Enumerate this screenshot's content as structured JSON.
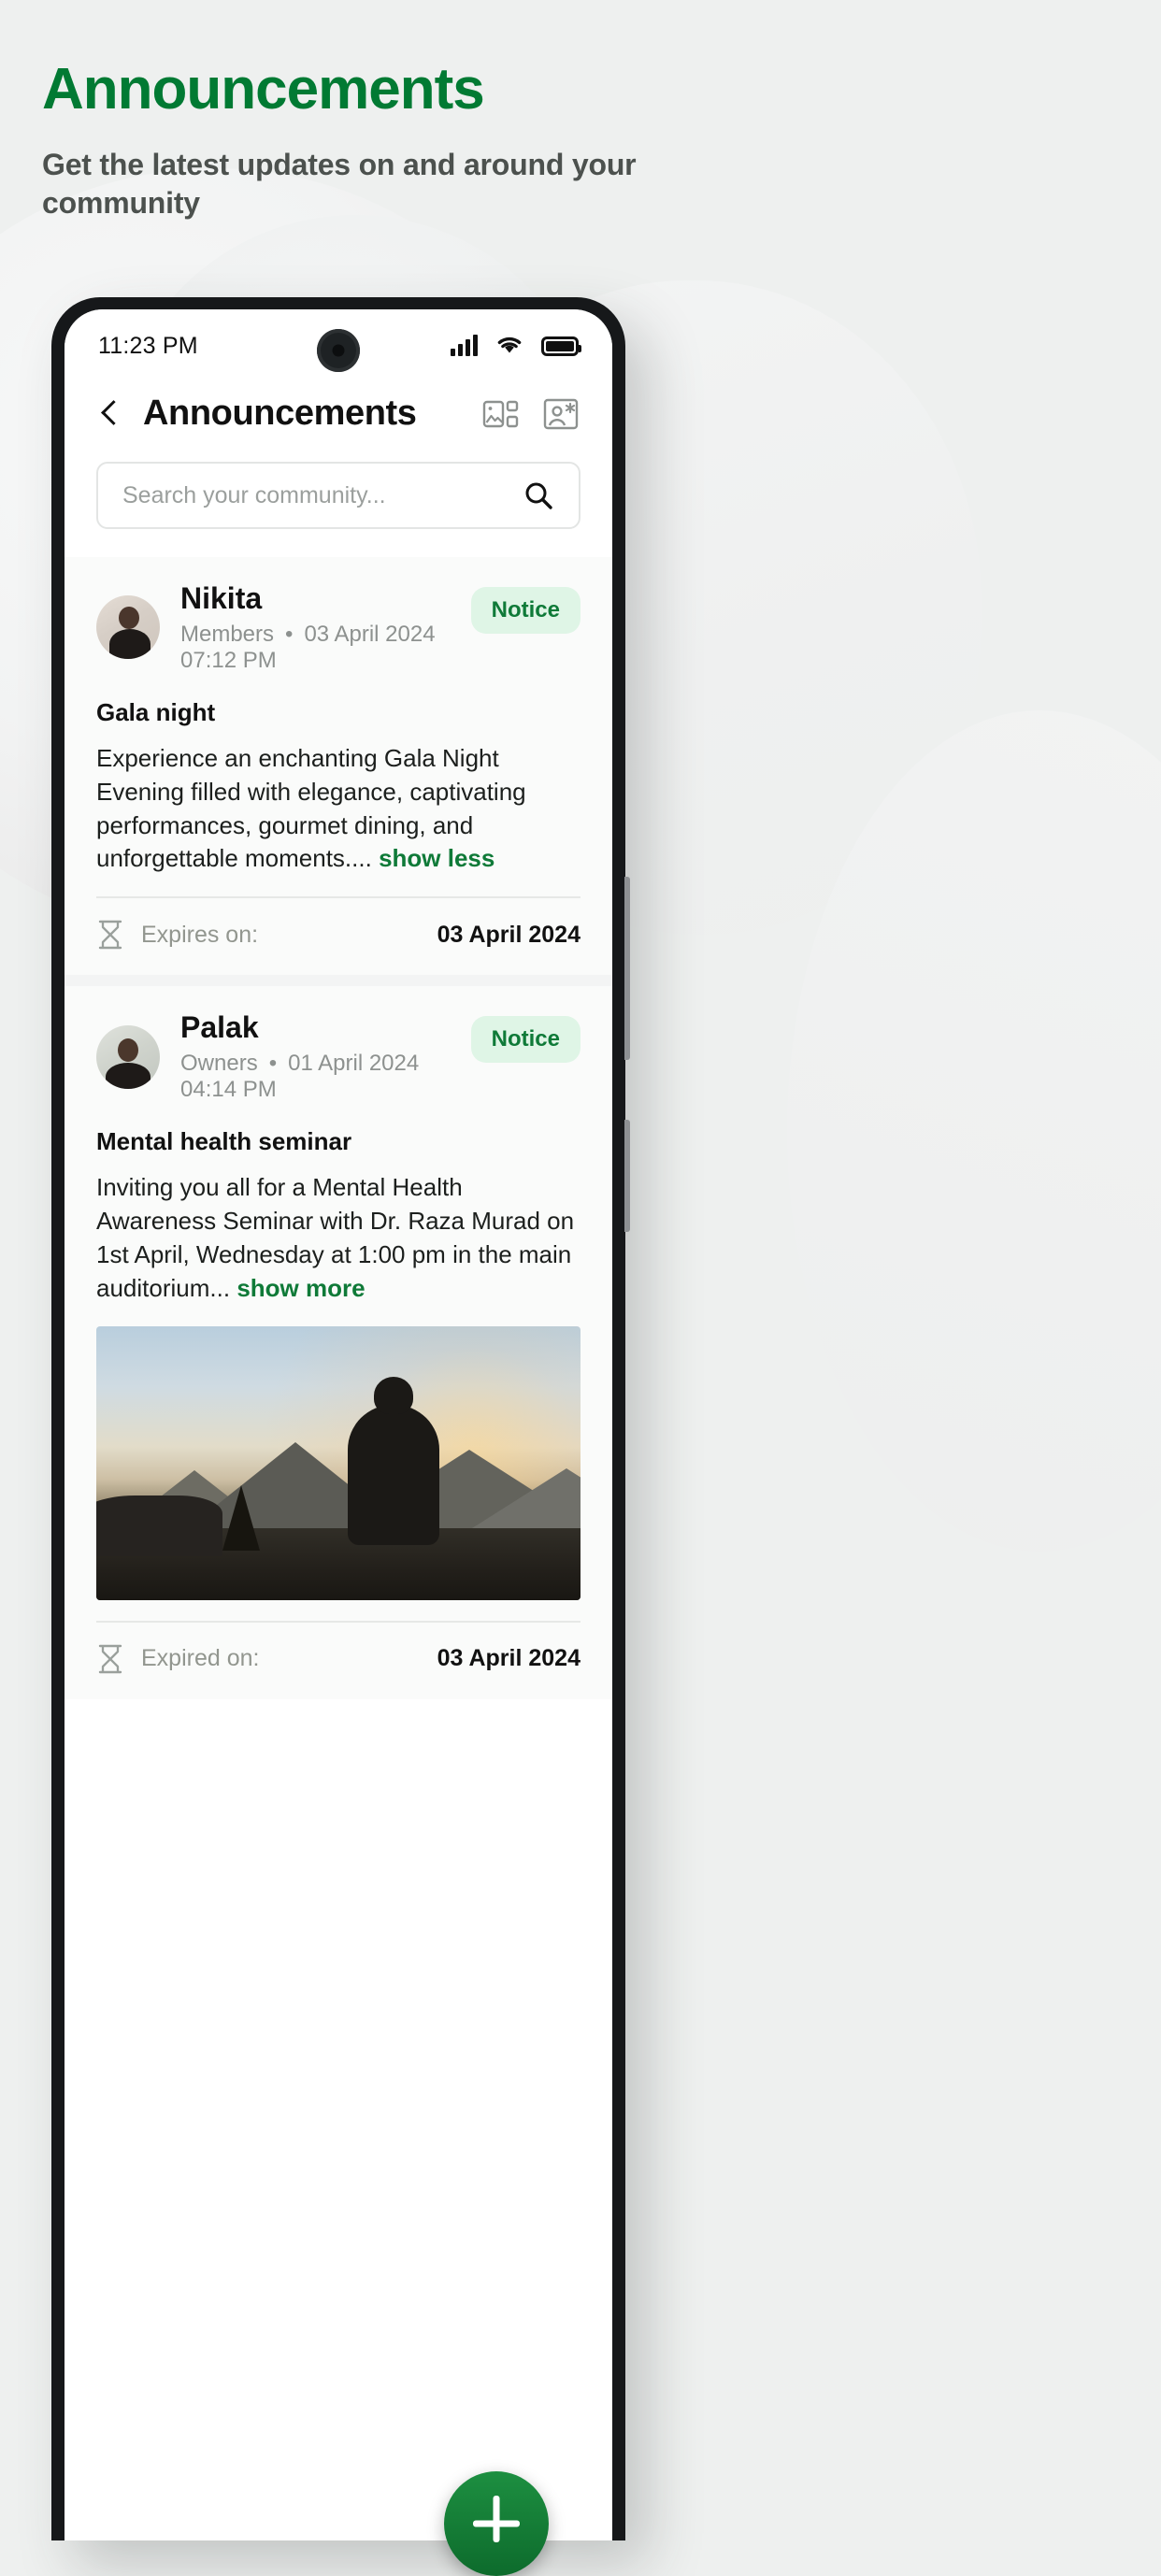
{
  "hero": {
    "title": "Announcements",
    "subtitle": "Get the latest updates on and around your community",
    "title_color": "#017a33",
    "subtitle_color": "#4c514e"
  },
  "status_bar": {
    "time": "11:23 PM",
    "signal_icon": "cellular-signal-icon",
    "wifi_icon": "wifi-icon",
    "battery_icon": "battery-full-icon"
  },
  "app_bar": {
    "back_icon": "back-chevron-icon",
    "title": "Announcements",
    "actions": [
      {
        "icon": "gallery-layout-icon"
      },
      {
        "icon": "profile-card-icon"
      }
    ]
  },
  "search": {
    "placeholder": "Search your community...",
    "value": "",
    "icon": "search-icon"
  },
  "feed": {
    "posts": [
      {
        "author": "Nikita",
        "role": "Members",
        "separator": "•",
        "date": "03 April 2024",
        "time": "07:12 PM",
        "badge": "Notice",
        "title": "Gala night",
        "body": "Experience an enchanting Gala Night Evening filled with elegance, captivating performances, gourmet dining, and unforgettable moments....",
        "more_link": "show less",
        "expiry_label": "Expires on:",
        "expiry_date": "03 April 2024",
        "expiry_icon": "hourglass-icon",
        "has_image": false,
        "avatar_class": "a1"
      },
      {
        "author": "Palak",
        "role": "Owners",
        "separator": "•",
        "date": "01 April 2024",
        "time": "04:14 PM",
        "badge": "Notice",
        "title": "Mental health seminar",
        "body": "Inviting you all for a Mental Health Awareness Seminar with Dr. Raza Murad on 1st April, Wednesday at 1:00 pm in the main auditorium...",
        "more_link": "show more",
        "expiry_label": "Expired on:",
        "expiry_date": "03 April 2024",
        "expiry_icon": "hourglass-icon",
        "has_image": true,
        "image_alt": "person sitting on cliff watching mountain sunset",
        "avatar_class": "a2"
      }
    ]
  },
  "fab": {
    "icon": "plus-icon",
    "color": "#0d6b2c"
  },
  "colors": {
    "brand_green": "#017a33",
    "badge_bg": "#dff5e6",
    "badge_text": "#0f7a38",
    "page_bg": "#eef0ef"
  }
}
